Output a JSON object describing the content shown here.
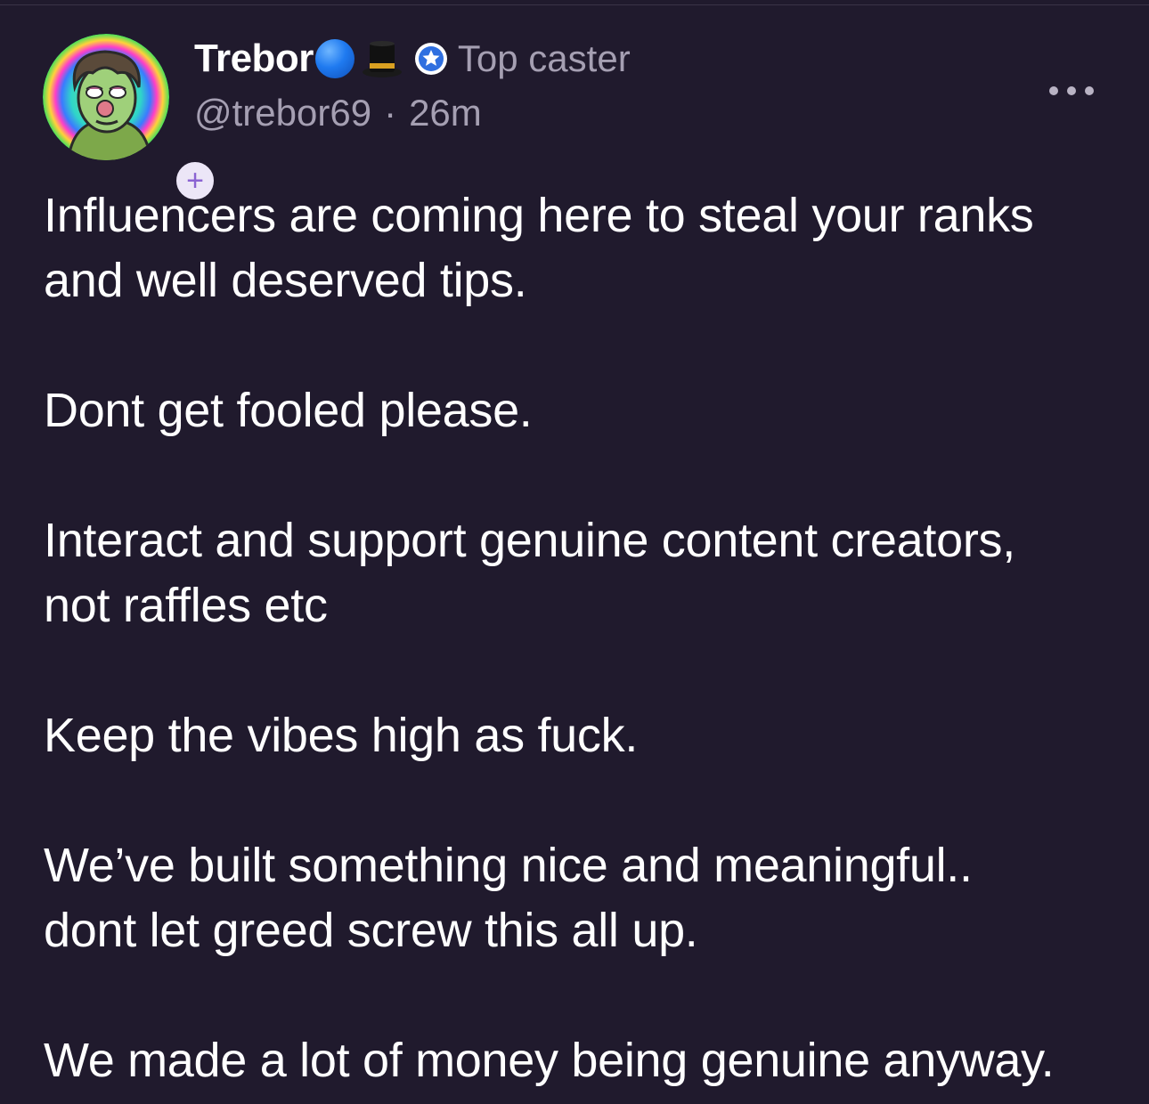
{
  "author": {
    "display_name": "Trebor",
    "emoji_1": "blue-circle",
    "emoji_2": "top-hat",
    "badge_icon": "star-badge-icon",
    "badge_label": "Top caster",
    "handle": "@trebor69",
    "separator": "·",
    "time_ago": "26m",
    "follow_symbol": "+"
  },
  "menu": {
    "icon": "more-horizontal-icon"
  },
  "cast": {
    "paragraphs": [
      {
        "lines": [
          "Influencers are coming here to steal your ranks",
          "and well deserved tips."
        ]
      },
      {
        "lines": [
          "Dont get fooled please."
        ]
      },
      {
        "lines": [
          "Interact and support genuine content creators,",
          "not raffles etc"
        ]
      },
      {
        "lines": [
          "Keep the vibes high as fuck."
        ]
      },
      {
        "lines": [
          "We’ve built something nice and meaningful..",
          "dont let greed screw this all up."
        ]
      },
      {
        "lines": [
          "We made a lot of money being genuine anyway."
        ]
      }
    ]
  },
  "colors": {
    "background": "#201a2d",
    "muted_text": "#a59fb2",
    "accent_purple": "#8a63d2"
  }
}
